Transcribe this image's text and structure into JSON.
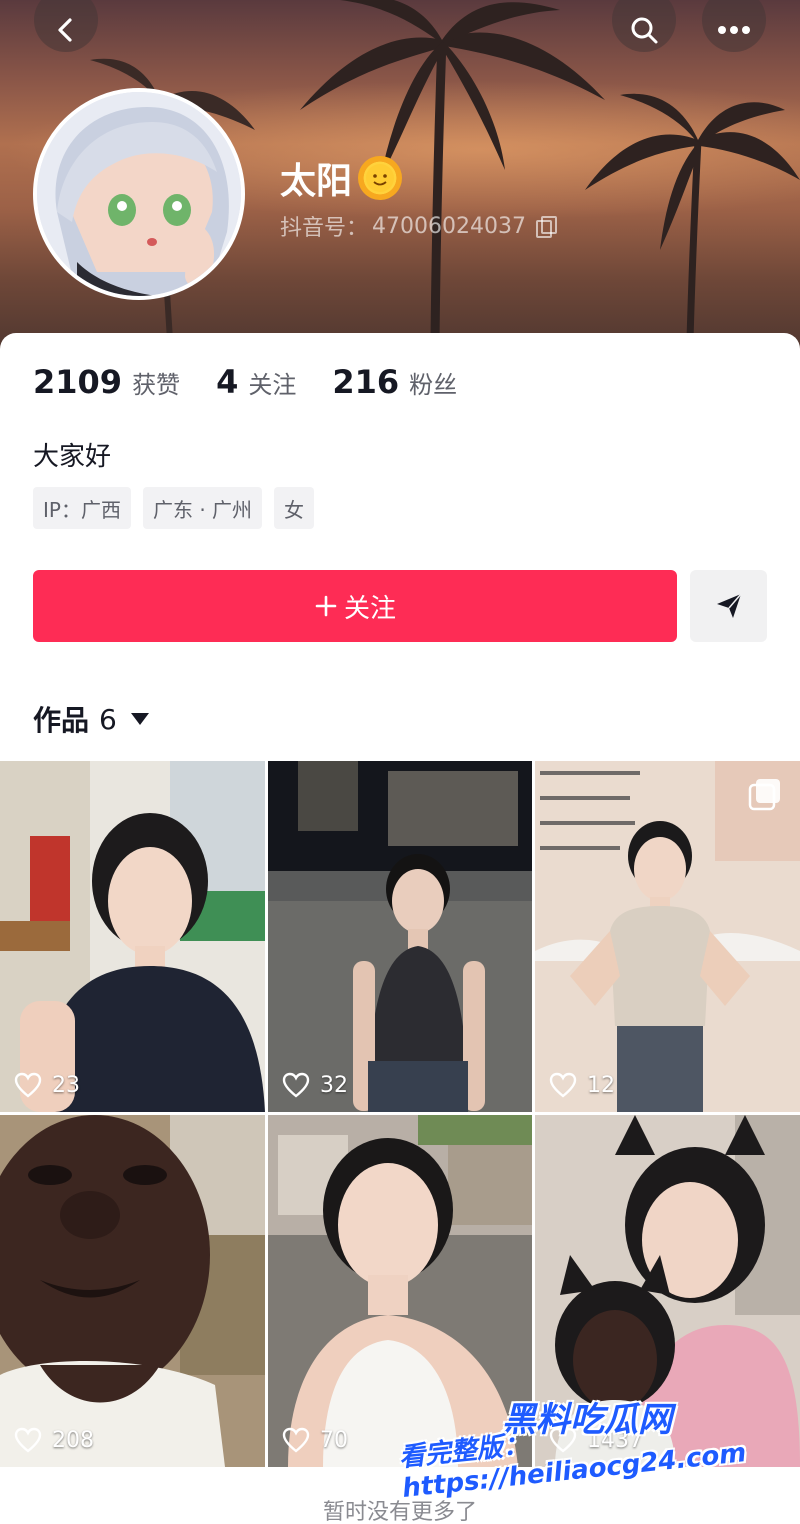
{
  "header": {
    "nickname": "太阳",
    "id_label": "抖音号：",
    "id_value": "47006024037"
  },
  "stats": [
    {
      "value": "2109",
      "label": "获赞"
    },
    {
      "value": "4",
      "label": "关注"
    },
    {
      "value": "216",
      "label": "粉丝"
    }
  ],
  "bio": "大家好",
  "tags": [
    "IP：广西",
    "广东 · 广州",
    "女"
  ],
  "follow_label": "关注",
  "works_tab": {
    "label": "作品",
    "count": "6"
  },
  "videos": [
    {
      "likes": "23"
    },
    {
      "likes": "32"
    },
    {
      "likes": "12"
    },
    {
      "likes": "208"
    },
    {
      "likes": "70"
    },
    {
      "likes": "1437"
    }
  ],
  "end_text": "暂时没有更多了",
  "watermark": {
    "line1": "黑料吃瓜网",
    "line2": "看完整版：https://heiliaocg24.com"
  },
  "colors": {
    "accent": "#fe2c55",
    "text": "#161823",
    "muted": "#5f616a"
  }
}
